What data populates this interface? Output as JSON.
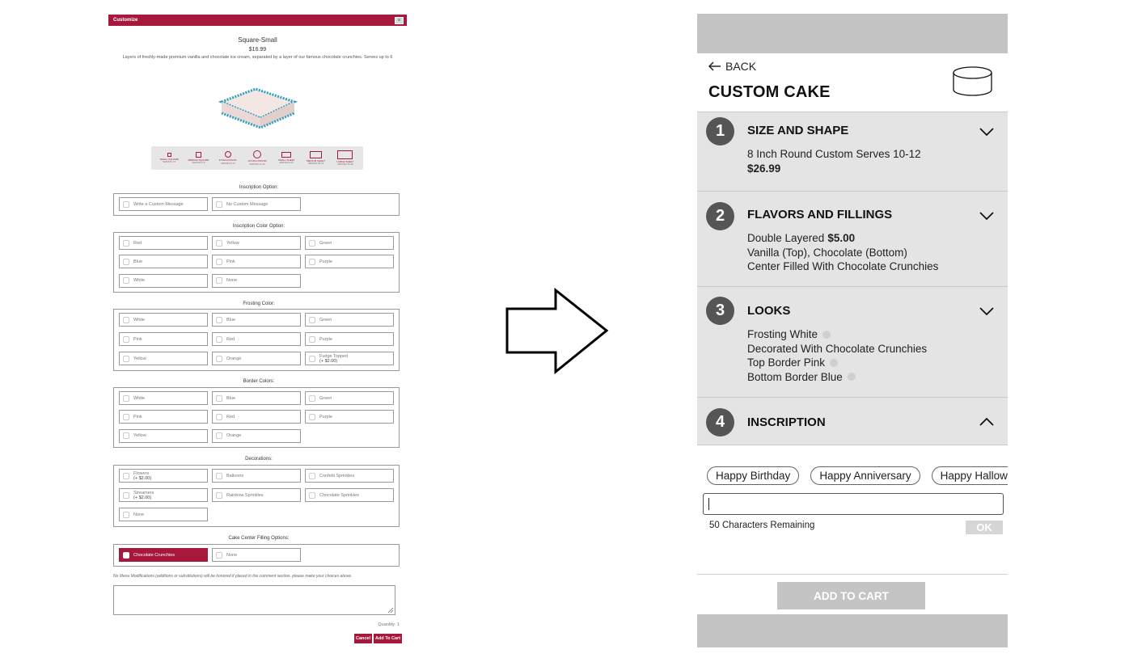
{
  "legacy": {
    "header_title": "Customize",
    "close_label": "×",
    "product_name": "Square-Small",
    "price": "$16.99",
    "description": "Layers of freshly-made premium vanilla and chocolate ice cream, separated by a layer of our famous chocolate crunchies. Serves up to 6",
    "sizes": [
      {
        "label": "SMALL SQUARE",
        "serves": "SERVES 4-6"
      },
      {
        "label": "MEDIUM SQUARE",
        "serves": "SERVES 6-9"
      },
      {
        "label": "8 INCH ROUND",
        "serves": "SERVES 8-10"
      },
      {
        "label": "10 INCH ROUND",
        "serves": "SERVES 12-16"
      },
      {
        "label": "SMALL SHEET",
        "serves": "SERVES 8-12"
      },
      {
        "label": "MEDIUM SHEET",
        "serves": "SERVES 18-24"
      },
      {
        "label": "LARGE SHEET",
        "serves": "SERVES 36-48"
      }
    ],
    "inscription_option": {
      "title": "Inscription Option:",
      "options": [
        "Write a Custom Message",
        "No Custom Message"
      ]
    },
    "inscription_color": {
      "title": "Inscription Color Option:",
      "options": [
        "Red",
        "Yellow",
        "Green",
        "Blue",
        "Pink",
        "Purple",
        "White",
        "None"
      ]
    },
    "frosting_color": {
      "title": "Frosting Color:",
      "options": [
        "White",
        "Blue",
        "Green",
        "Pink",
        "Red",
        "Purple",
        "Yellow",
        "Orange",
        "Fudge Topped"
      ],
      "fudge_price": "(+ $2.00)"
    },
    "border_colors": {
      "title": "Border Colors:",
      "options": [
        "White",
        "Blue",
        "Green",
        "Pink",
        "Red",
        "Purple",
        "Yellow",
        "Orange"
      ]
    },
    "decorations": {
      "title": "Decorations:",
      "options": [
        "Flowers",
        "Balloons",
        "Confetti Sprinkles",
        "Streamers",
        "Rainbow Sprinkles",
        "Chocolate Sprinkles",
        "None"
      ],
      "flowers_price": "(+ $2.00)",
      "streamers_price": "(+ $2.00)"
    },
    "center_filling": {
      "title": "Cake Center Filling Options:",
      "options": [
        "Chocolate Crunchies",
        "None"
      ],
      "selected": "Chocolate Crunchies"
    },
    "note": "No Menu Modifications (additions or substitutions) will be honored if placed in the comment section, please make your choices above.",
    "quantity_label": "Quantity: 1",
    "cancel_label": "Cancel",
    "add_to_cart_label": "Add To Cart",
    "accent_color": "#a6193c"
  },
  "mobile": {
    "back_label": "BACK",
    "title": "CUSTOM CAKE",
    "sections": [
      {
        "number": "1",
        "title": "SIZE AND SHAPE",
        "expanded": false,
        "line1": "8 Inch Round Custom  Serves 10-12",
        "price": "$26.99"
      },
      {
        "number": "2",
        "title": "FLAVORS AND FILLINGS",
        "expanded": false,
        "line1_text": "Double Layered",
        "line1_price": "$5.00",
        "line2": "Vanilla (Top), Chocolate (Bottom)",
        "line3": "Center Filled With Chocolate Crunchies"
      },
      {
        "number": "3",
        "title": "LOOKS",
        "expanded": false,
        "line1": "Frosting White",
        "line2": "Decorated With Chocolate Crunchies",
        "line3": "Top Border Pink",
        "line4": "Bottom Border Blue"
      },
      {
        "number": "4",
        "title": "INSCRIPTION",
        "expanded": true
      }
    ],
    "inscription_chips": [
      "Happy Birthday",
      "Happy Anniversary",
      "Happy Halloween"
    ],
    "inscription_value": "",
    "characters_remaining": "50 Characters Remaining",
    "ok_label": "OK",
    "add_to_cart_label": "ADD TO CART",
    "bar_color": "#c4c4c4",
    "section_bg": "#e4e4e4"
  }
}
